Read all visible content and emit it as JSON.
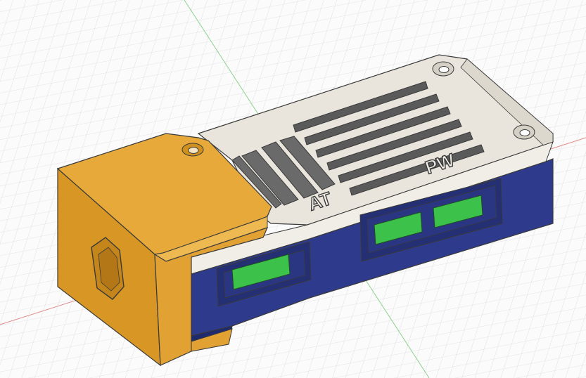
{
  "viewport": {
    "background": "#fbfbfb",
    "grid_color": "#d9d9d9",
    "axis_green": "#8fd08f",
    "axis_red": "#e08a8a"
  },
  "model": {
    "colors": {
      "lid_top": "#e9e5dc",
      "lid_side": "#f1eee7",
      "body_blue": "#2e3a8c",
      "body_blue_dark": "#1f2a6e",
      "cap_orange_top": "#e7a93a",
      "cap_orange_side": "#d89624",
      "cap_orange_front": "#e2a233",
      "led_green": "#3cc24a",
      "vent_dark": "#555555",
      "edge": "#3a3a3a"
    },
    "labels": {
      "at": "AT",
      "pw": "PW"
    }
  }
}
